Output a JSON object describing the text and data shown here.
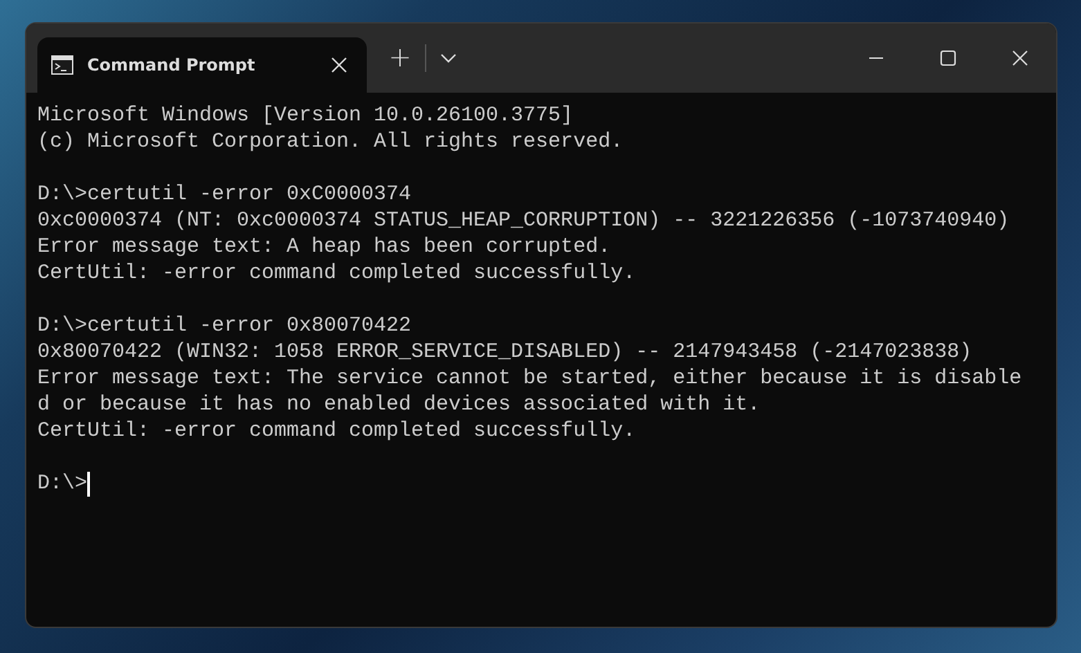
{
  "tabs": [
    {
      "title": "Command Prompt",
      "selected": true
    }
  ],
  "new_tab_button": "+",
  "blocks": [
    [
      "Microsoft Windows [Version 10.0.26100.3775]",
      "(c) Microsoft Corporation. All rights reserved."
    ],
    [
      "D:\\>certutil -error 0xC0000374",
      "0xc0000374 (NT: 0xc0000374 STATUS_HEAP_CORRUPTION) -- 3221226356 (-1073740940)",
      "Error message text: A heap has been corrupted.",
      "CertUtil: -error command completed successfully."
    ],
    [
      "D:\\>certutil -error 0x80070422",
      "0x80070422 (WIN32: 1058 ERROR_SERVICE_DISABLED) -- 2147943458 (-2147023838)",
      "Error message text: The service cannot be started, either because it is disable",
      "d or because it has no enabled devices associated with it.",
      "CertUtil: -error command completed successfully."
    ]
  ],
  "prompt": {
    "text": "D:\\>",
    "cursor": true
  }
}
